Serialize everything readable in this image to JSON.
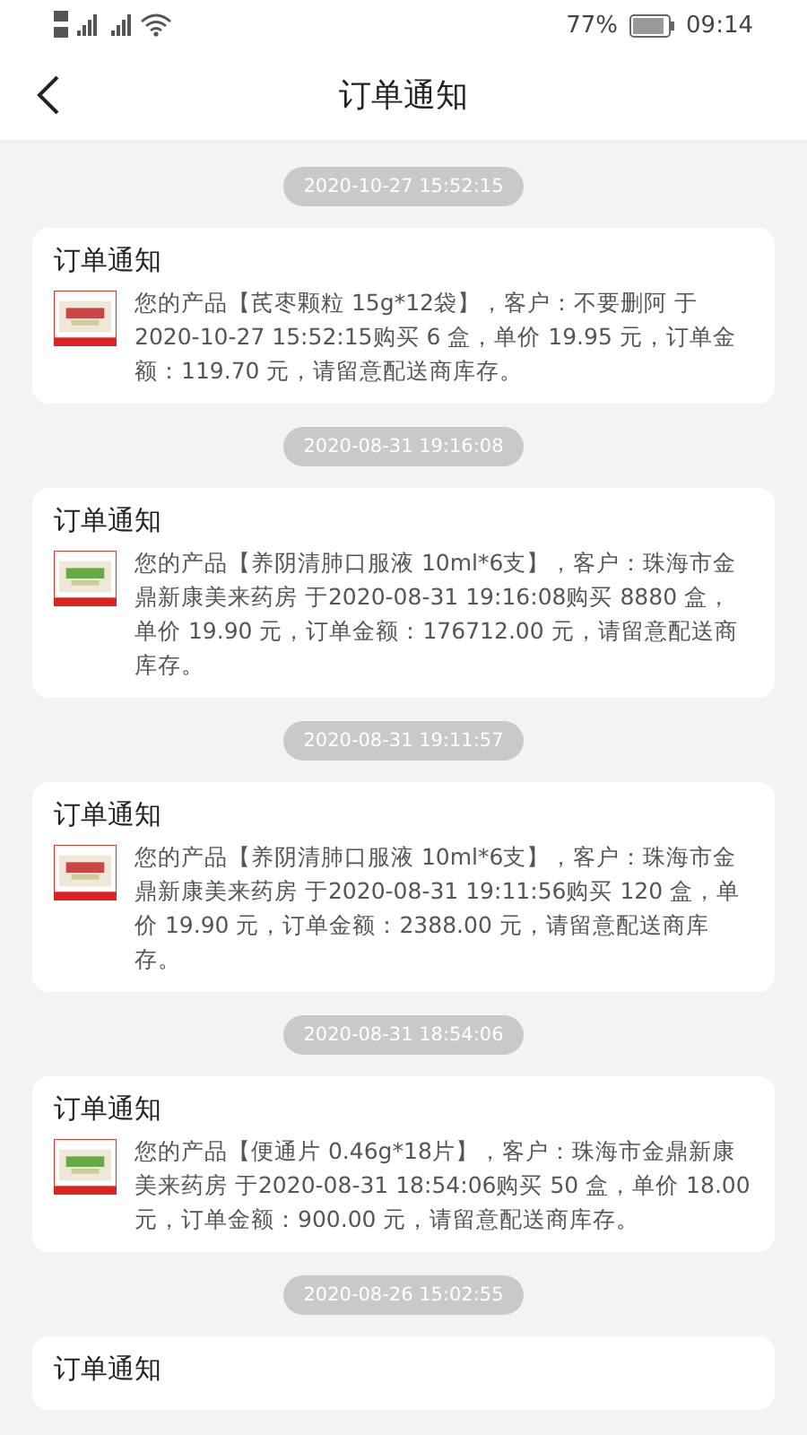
{
  "status_bar": {
    "battery": "77%",
    "time": "09:14"
  },
  "header": {
    "title": "订单通知"
  },
  "notifications": [
    {
      "time": "2020-10-27 15:52:15",
      "title": "订单通知",
      "text": "您的产品【芪枣颗粒 15g*12袋】，客户：不要删阿 于2020-10-27 15:52:15购买 6 盒，单价 19.95 元，订单金额：119.70 元，请留意配送商库存。"
    },
    {
      "time": "2020-08-31 19:16:08",
      "title": "订单通知",
      "text": "您的产品【养阴清肺口服液 10ml*6支】，客户：珠海市金鼎新康美来药房 于2020-08-31 19:16:08购买 8880 盒，单价 19.90 元，订单金额：176712.00 元，请留意配送商库存。"
    },
    {
      "time": "2020-08-31 19:11:57",
      "title": "订单通知",
      "text": "您的产品【养阴清肺口服液 10ml*6支】，客户：珠海市金鼎新康美来药房 于2020-08-31 19:11:56购买 120 盒，单价 19.90 元，订单金额：2388.00 元，请留意配送商库存。"
    },
    {
      "time": "2020-08-31 18:54:06",
      "title": "订单通知",
      "text": "您的产品【便通片 0.46g*18片】，客户：珠海市金鼎新康美来药房 于2020-08-31 18:54:06购买 50 盒，单价 18.00 元，订单金额：900.00 元，请留意配送商库存。"
    },
    {
      "time": "2020-08-26 15:02:55",
      "title": "订单通知"
    }
  ]
}
